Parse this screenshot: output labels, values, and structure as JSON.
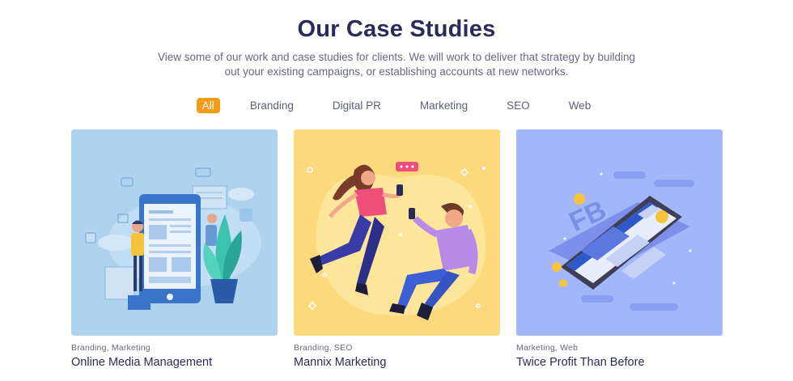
{
  "header": {
    "title": "Our Case Studies",
    "subtitle": "View some of our work and case studies for clients. We will work to deliver that strategy by building out your existing campaigns, or establishing accounts at new networks."
  },
  "filters": [
    {
      "label": "All",
      "active": true
    },
    {
      "label": "Branding",
      "active": false
    },
    {
      "label": "Digital PR",
      "active": false
    },
    {
      "label": "Marketing",
      "active": false
    },
    {
      "label": "SEO",
      "active": false
    },
    {
      "label": "Web",
      "active": false
    }
  ],
  "cards": [
    {
      "categories": "Branding, Marketing",
      "title": "Online Media Management",
      "bg": "#aed3ef"
    },
    {
      "categories": "Branding, SEO",
      "title": "Mannix Marketing",
      "bg": "#fbd97c"
    },
    {
      "categories": "Marketing, Web",
      "title": "Twice Profit Than Before",
      "bg": "#a3b6fa"
    }
  ],
  "accent_color": "#f49b17"
}
